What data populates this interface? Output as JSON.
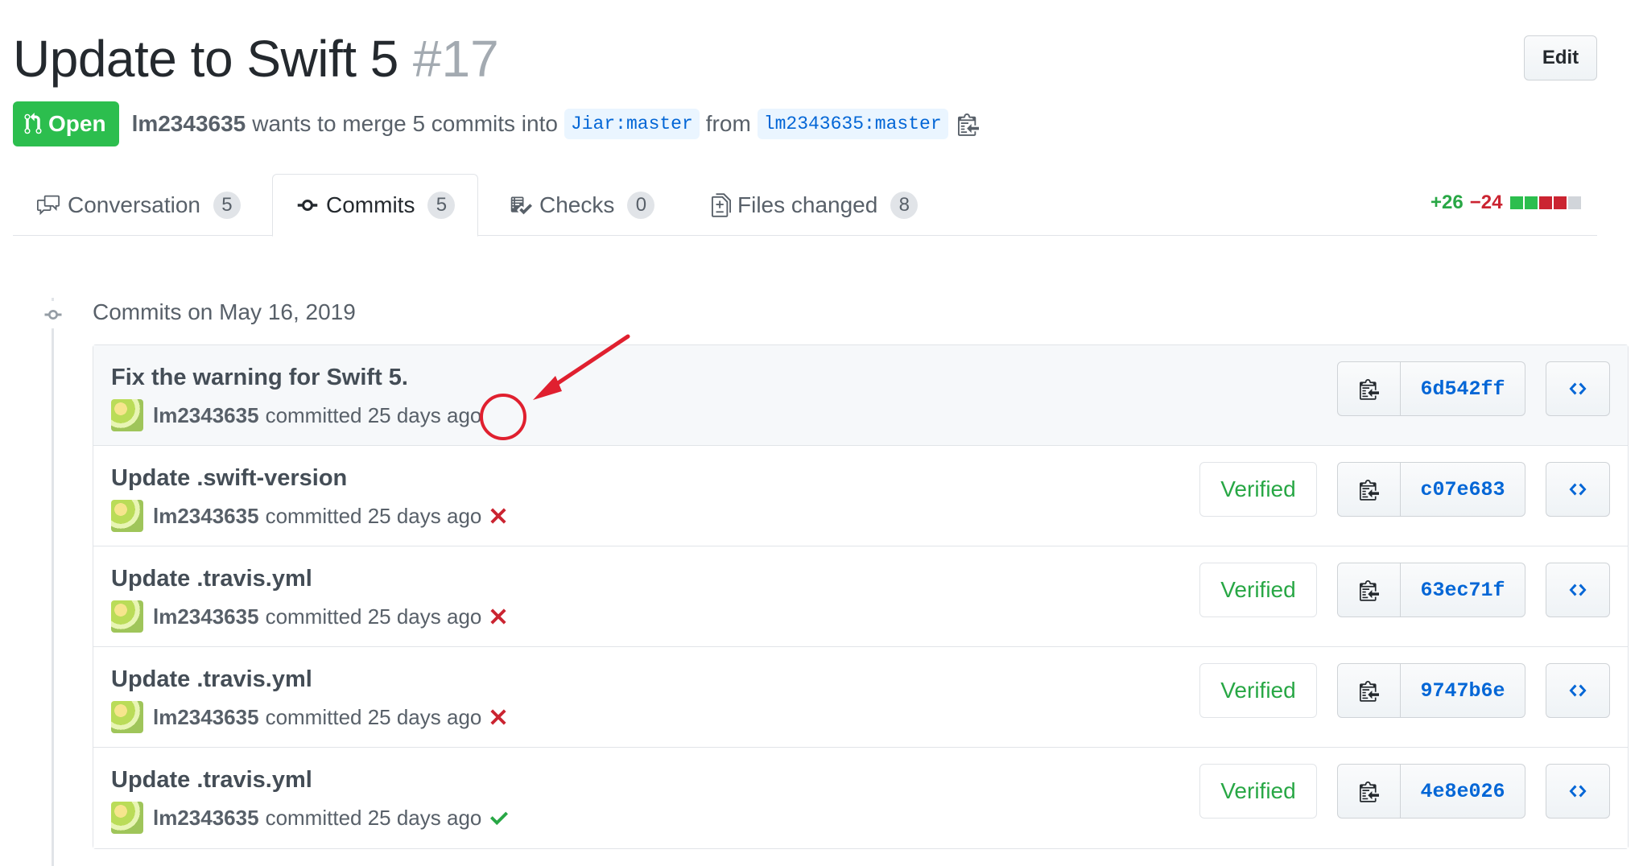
{
  "pr": {
    "title": "Update to Swift 5",
    "number": "#17",
    "edit_label": "Edit",
    "state_label": "Open",
    "author": "lm2343635",
    "merge_text": "wants to merge 5 commits into",
    "base_branch": "Jiar:master",
    "from_text": "from",
    "head_branch": "lm2343635:master"
  },
  "tabs": [
    {
      "label": "Conversation",
      "count": "5",
      "icon": "comment-discussion-icon"
    },
    {
      "label": "Commits",
      "count": "5",
      "icon": "git-commit-icon"
    },
    {
      "label": "Checks",
      "count": "0",
      "icon": "checklist-icon"
    },
    {
      "label": "Files changed",
      "count": "8",
      "icon": "file-diff-icon"
    }
  ],
  "diffstat": {
    "additions": "+26",
    "deletions": "−24"
  },
  "colors": {
    "green": "#2cbe4e",
    "red": "#cb2431",
    "blue": "#0366d6",
    "annotation": "#e0202f"
  },
  "commits_date": "Commits on May 16, 2019",
  "commits": [
    {
      "message": "Fix the warning for Swift 5.",
      "author": "lm2343635",
      "time": "committed 25 days ago",
      "status": "none",
      "verified": "",
      "sha": "6d542ff"
    },
    {
      "message": "Update .swift-version",
      "author": "lm2343635",
      "time": "committed 25 days ago",
      "status": "failure",
      "verified": "Verified",
      "sha": "c07e683"
    },
    {
      "message": "Update .travis.yml",
      "author": "lm2343635",
      "time": "committed 25 days ago",
      "status": "failure",
      "verified": "Verified",
      "sha": "63ec71f"
    },
    {
      "message": "Update .travis.yml",
      "author": "lm2343635",
      "time": "committed 25 days ago",
      "status": "failure",
      "verified": "Verified",
      "sha": "9747b6e"
    },
    {
      "message": "Update .travis.yml",
      "author": "lm2343635",
      "time": "committed 25 days ago",
      "status": "success",
      "verified": "Verified",
      "sha": "4e8e026"
    }
  ]
}
